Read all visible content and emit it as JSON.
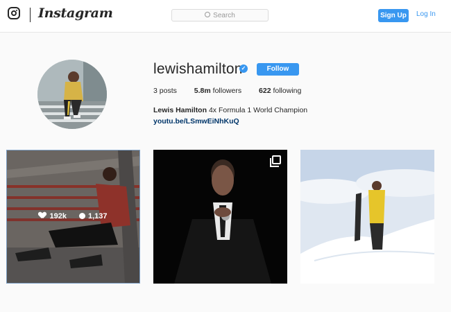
{
  "header": {
    "brand": "Instagram",
    "search_placeholder": "Search",
    "signup_label": "Sign Up",
    "login_label": "Log In",
    "accent_color": "#3897f0"
  },
  "profile": {
    "username": "lewishamilton",
    "verified_mark": "✓",
    "follow_label": "Follow",
    "stats": {
      "posts_count": "3",
      "posts_label": "posts",
      "followers_count": "5.8m",
      "followers_label": "followers",
      "following_count": "622",
      "following_label": "following"
    },
    "bio_name": "Lewis Hamilton",
    "bio_text": "4x Formula 1 World Champion",
    "link": "youtu.be/LSmwEiNhKuQ"
  },
  "posts": [
    {
      "likes": "192k",
      "comments": "1,137",
      "hovered": true
    },
    {
      "multi_image": true
    },
    {}
  ],
  "icons": [
    "instagram-logo-icon",
    "search-icon",
    "verified-badge-icon",
    "heart-icon",
    "comment-icon",
    "multiple-images-icon"
  ]
}
